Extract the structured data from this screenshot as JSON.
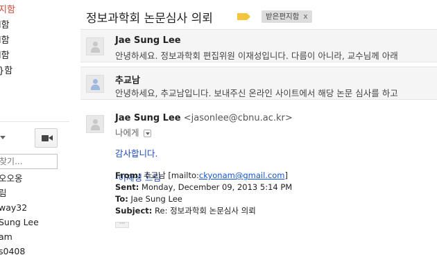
{
  "sidebar": {
    "folders": [
      {
        "label": "지함",
        "active": true
      },
      {
        "label": "l함",
        "active": false
      },
      {
        "label": "l함",
        "active": false
      },
      {
        "label": "l함",
        "active": false
      },
      {
        "label": "}함",
        "active": false
      }
    ],
    "chat_search_placeholder": "찾기...",
    "contacts": [
      "오오옹",
      "림",
      "way32",
      "Sung Lee",
      "am",
      "s0408"
    ]
  },
  "thread": {
    "subject": "정보과학회 논문심사 의뢰",
    "label": "받은편지함",
    "label_remove": "x",
    "collapsed": [
      {
        "sender": "Jae Sung Lee",
        "snippet": "안녕하세요. 정보과학회 편집위원 이재성입니다. 다름이 아니라, 교수님께 아래"
      },
      {
        "sender": "추교남",
        "snippet": "안녕하세요, 추교남입니다. 보내주신 온라인 사이트에서 해당 논문 심사를 하고"
      }
    ],
    "expanded": {
      "sender": "Jae Sung Lee",
      "email": "<jasonlee@cbnu.ac.kr>",
      "to": "나에게",
      "body_lines": [
        "감사합니다.",
        "-이재성 드림"
      ],
      "quote": {
        "from_label": "From:",
        "from_name": "추교남 [mailto:",
        "from_link": "ckyonam@gmail.com",
        "from_close": "]",
        "sent_label": "Sent:",
        "sent_value": "Monday, December 09, 2013 5:14 PM",
        "to_label": "To:",
        "to_value": "Jae Sung Lee",
        "subject_label": "Subject:",
        "subject_value": "Re: 정보과학회 논문심사 의뢰"
      },
      "show_trimmed": "···"
    }
  }
}
